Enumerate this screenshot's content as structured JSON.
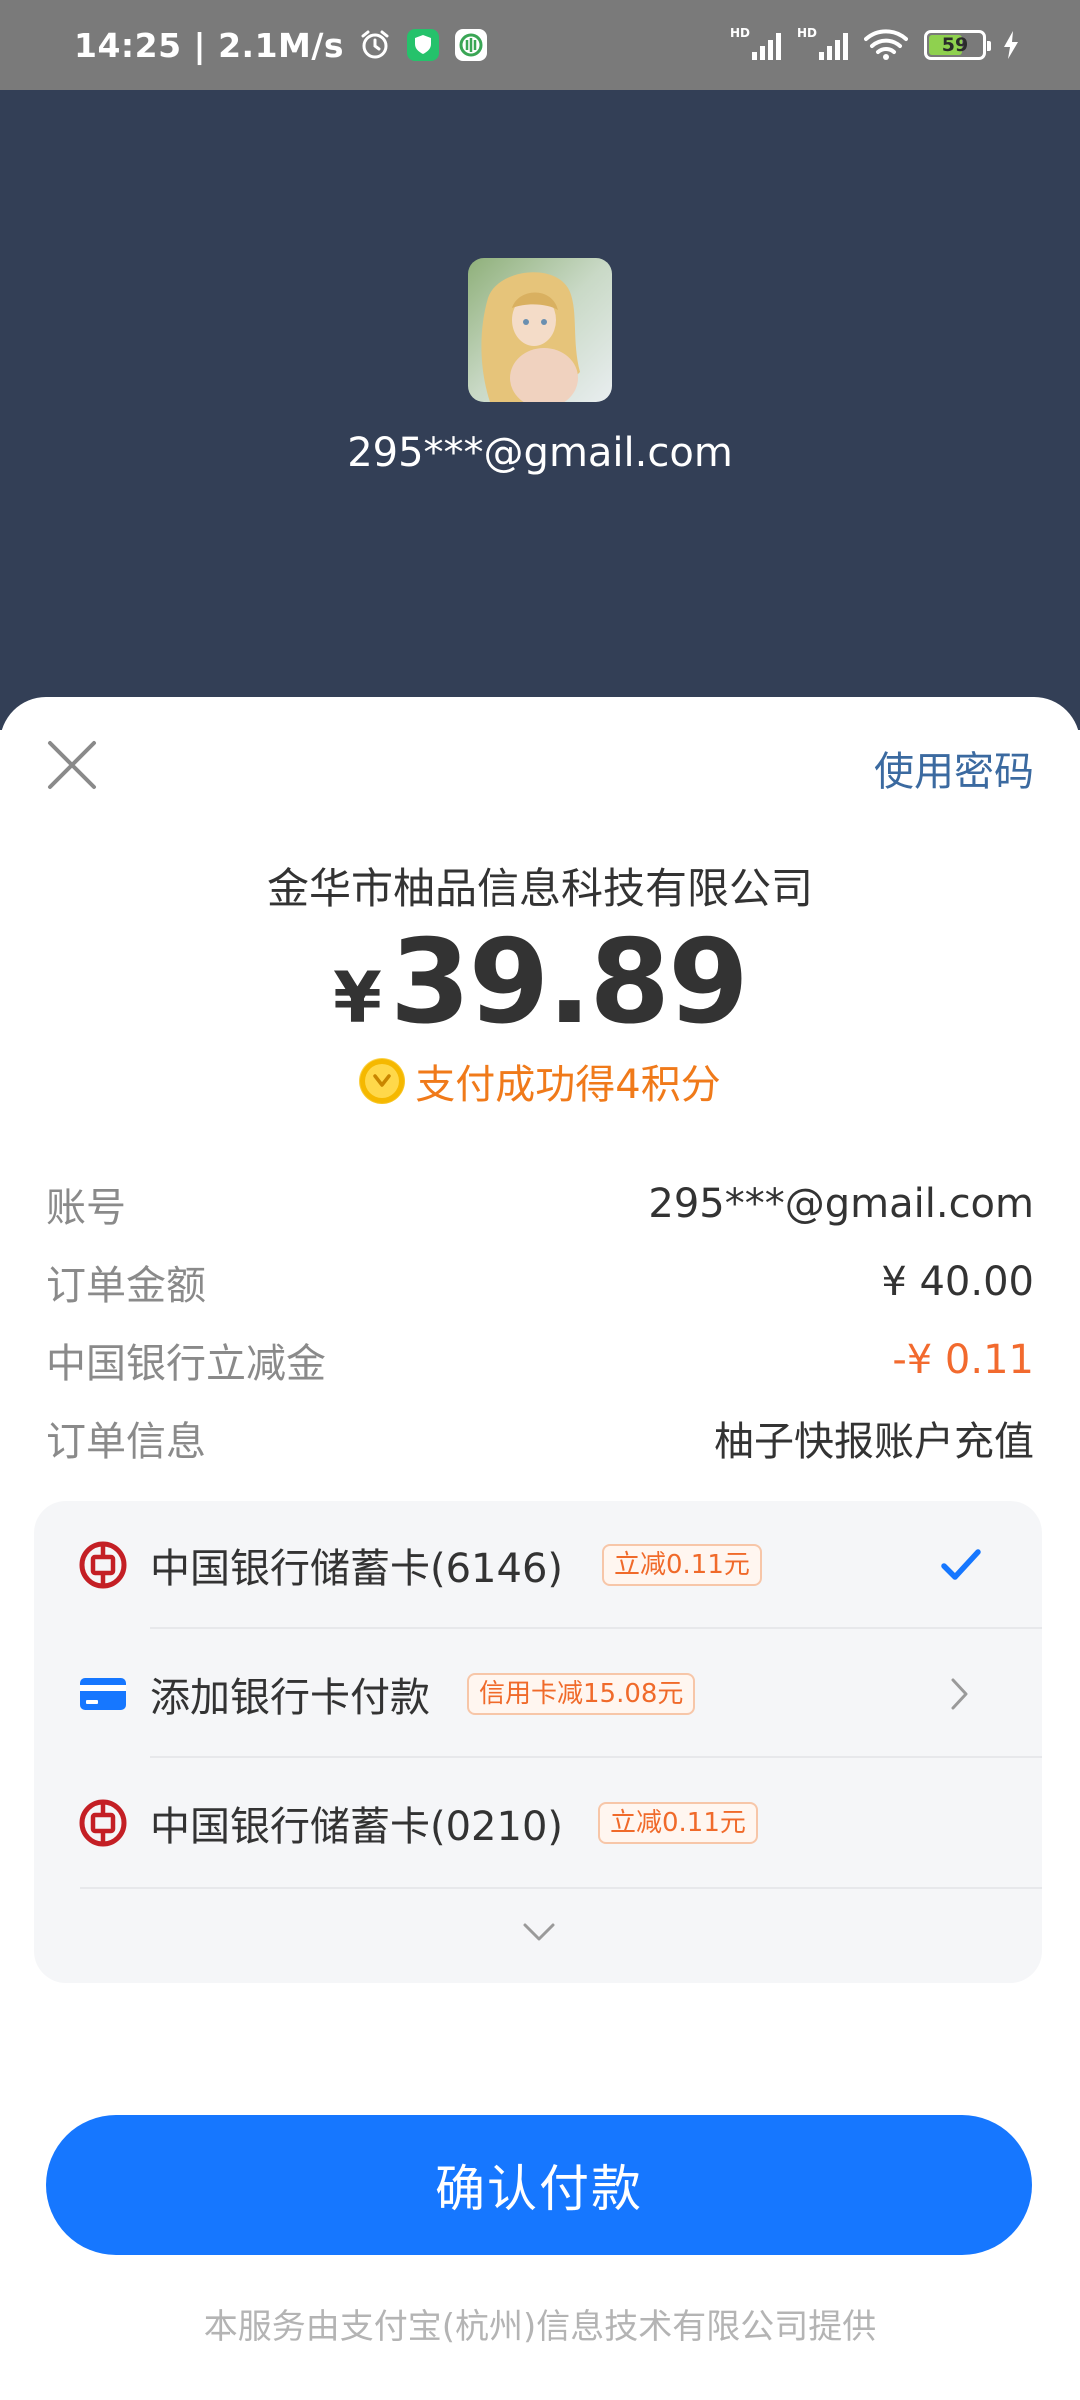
{
  "status_bar": {
    "time_speed": "14:25 | 2.1M/s",
    "battery_level": "59",
    "signal_label_1": "HD",
    "signal_label_2": "HD"
  },
  "header": {
    "account": "295***@gmail.com"
  },
  "sheet": {
    "use_password_label": "使用密码",
    "merchant": "金华市柚品信息科技有限公司",
    "currency_symbol": "¥",
    "amount": "39.89",
    "reward_text": "支付成功得4积分"
  },
  "info": [
    {
      "label": "账号",
      "value": "295***@gmail.com",
      "type": "normal"
    },
    {
      "label": "订单金额",
      "value": "¥ 40.00",
      "type": "normal"
    },
    {
      "label": "中国银行立减金",
      "value": "-¥ 0.11",
      "type": "discount"
    },
    {
      "label": "订单信息",
      "value": "柚子快报账户充值",
      "type": "normal"
    }
  ],
  "methods": [
    {
      "name": "中国银行储蓄卡(6146)",
      "badge": "立减0.11元",
      "selected": true
    },
    {
      "name": "添加银行卡付款",
      "badge": "信用卡减15.08元",
      "selected": false
    },
    {
      "name": "中国银行储蓄卡(0210)",
      "badge": "立减0.11元",
      "selected": false
    }
  ],
  "colors": {
    "header_bg": "#333f56",
    "accent": "#1677ff",
    "discount": "#f26a2e",
    "reward": "#f07a1a"
  },
  "confirm_label": "确认付款",
  "footer_note": "本服务由支付宝(杭州)信息技术有限公司提供"
}
